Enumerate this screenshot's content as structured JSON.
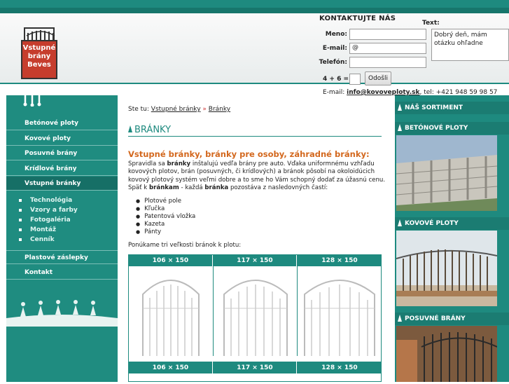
{
  "header": {
    "logo_text": [
      "Vstupné",
      "brány",
      "Beves"
    ],
    "contact_title": "KONTAKTUJTE NÁS",
    "fields": {
      "name_label": "Meno:",
      "email_label": "E-mail:",
      "email_value": "@",
      "phone_label": "Telefón:",
      "text_label": "Text:",
      "text_value": "Dobrý deň, mám otázku ohľadne"
    },
    "captcha": "4 + 6 =",
    "send_label": "Odošli",
    "contact_email_label": "E-mail:",
    "contact_email": "info@kovoveploty.sk",
    "contact_phone_label": "tel:",
    "contact_phone": "+421 948 59 98 57"
  },
  "nav": {
    "items": [
      {
        "label": "Betónové ploty"
      },
      {
        "label": "Kovové ploty"
      },
      {
        "label": "Posuvné brány"
      },
      {
        "label": "Krídlové brány"
      },
      {
        "label": "Vstupné bránky"
      }
    ],
    "sub": [
      {
        "label": "Technológia"
      },
      {
        "label": "Vzory a farby"
      },
      {
        "label": "Fotogaléria"
      },
      {
        "label": "Montáž"
      },
      {
        "label": "Cenník"
      }
    ],
    "items2": [
      {
        "label": "Plastové záslepky"
      },
      {
        "label": "Kontakt"
      }
    ]
  },
  "breadcrumb": {
    "prefix": "Ste tu:",
    "link1": "Vstupné bránky",
    "sep": "»",
    "link2": "Bránky"
  },
  "content": {
    "title": "BRÁNKY",
    "subtitle": "Vstupné bránky, bránky pre osoby, záhradné bránky:",
    "para_1": "Spravidla sa ",
    "para_b1": "bránky",
    "para_2": " inštalujú vedľa brány pre auto. Vďaka uniformnému vzhľadu kovových plotov, brán (posuvných, či krídlových) a bránok pôsobí na okoloidúcich kovový plotový systém veľmi dobre a to sme ho Vám schopný dodať za úžasnú cenu. Späť k ",
    "para_b2": "bránkam",
    "para_3": " - každá ",
    "para_b3": "bránka",
    "para_4": " pozostáva z nasledovných častí:",
    "parts": [
      "Plotové pole",
      "Kľučka",
      "Patentová vložka",
      "Kazeta",
      "Pánty"
    ],
    "sizes_intro": "Ponúkame tri veľkosti bránok k plotu:",
    "sizes": [
      "106 × 150",
      "117 × 150",
      "128 × 150"
    ]
  },
  "sidebar": {
    "sortiment": "NÁŠ SORTIMENT",
    "sections": [
      {
        "label": "BETÓNOVÉ PLOTY"
      },
      {
        "label": "KOVOVÉ PLOTY"
      },
      {
        "label": "POSUVNÉ BRÁNY"
      }
    ]
  },
  "colors": {
    "teal": "#1e8a7f",
    "orange": "#d3681e",
    "red": "#c63d2d"
  }
}
